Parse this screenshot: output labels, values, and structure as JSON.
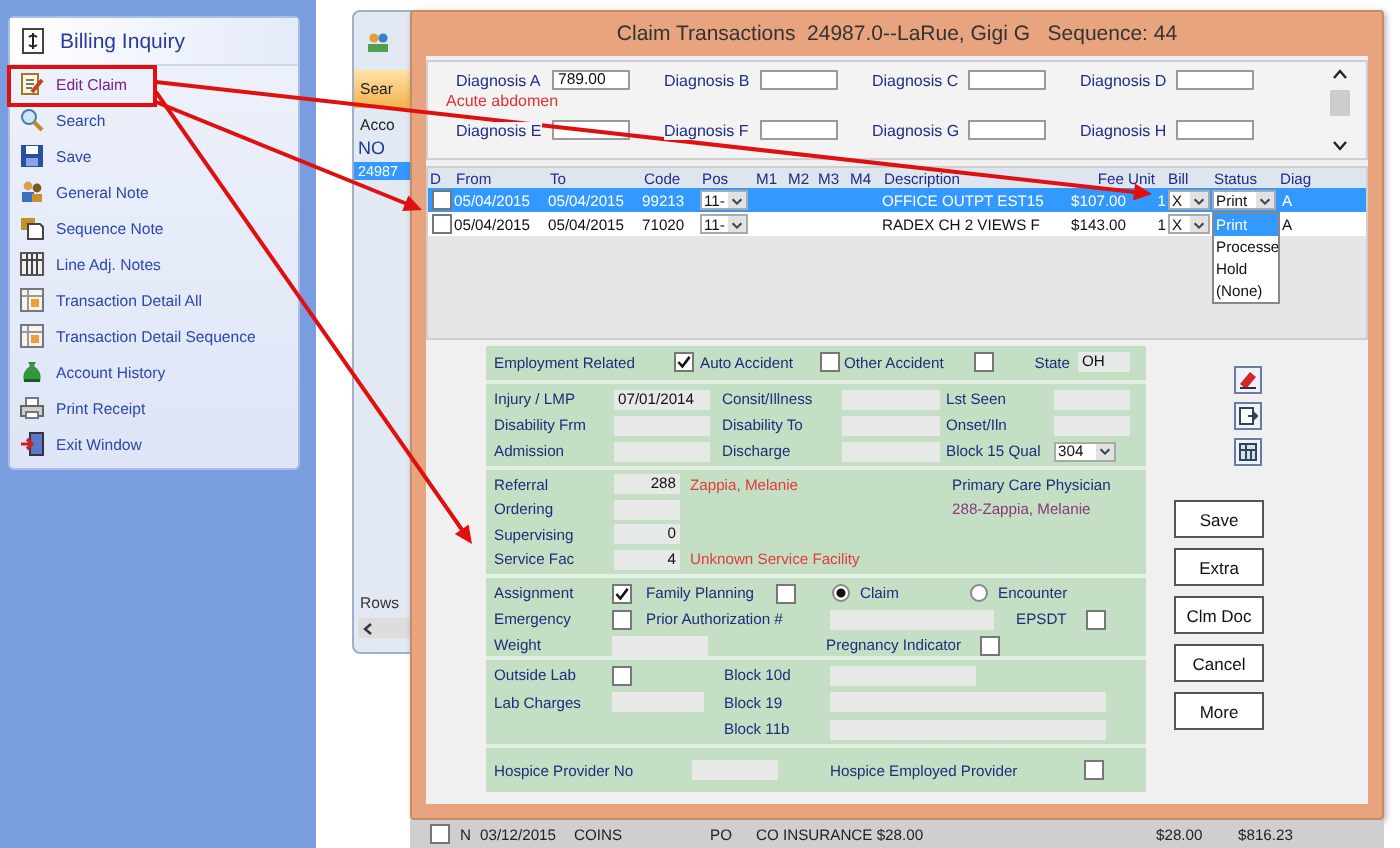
{
  "sidebar": {
    "title": "Billing Inquiry",
    "items": [
      {
        "label": "Edit Claim",
        "selected": true
      },
      {
        "label": "Search",
        "selected": false
      },
      {
        "label": "Save",
        "selected": false
      },
      {
        "label": "General Note",
        "selected": false
      },
      {
        "label": "Sequence Note",
        "selected": false
      },
      {
        "label": "Line Adj. Notes",
        "selected": false
      },
      {
        "label": "Transaction Detail All",
        "selected": false
      },
      {
        "label": "Transaction Detail Sequence",
        "selected": false
      },
      {
        "label": "Account History",
        "selected": false
      },
      {
        "label": "Print Receipt",
        "selected": false
      },
      {
        "label": "Exit Window",
        "selected": false
      }
    ]
  },
  "back_window": {
    "tab": "Sear",
    "column_1": "Acco",
    "rows": [
      {
        "text": "NO",
        "selected": false
      },
      {
        "text": "24987",
        "selected": true
      }
    ],
    "footer": "Rows"
  },
  "dialog": {
    "title": "Claim Transactions  24987.0--LaRue, Gigi G   Sequence: 44",
    "diagnoses": [
      {
        "label": "Diagnosis A",
        "value": "789.00",
        "note": "Acute abdomen"
      },
      {
        "label": "Diagnosis B"
      },
      {
        "label": "Diagnosis C"
      },
      {
        "label": "Diagnosis D"
      },
      {
        "label": "Diagnosis E"
      },
      {
        "label": "Diagnosis F"
      },
      {
        "label": "Diagnosis G"
      },
      {
        "label": "Diagnosis H"
      }
    ],
    "table": {
      "columns": [
        "D",
        "From",
        "To",
        "Code",
        "Pos",
        "M1",
        "M2",
        "M3",
        "M4",
        "Description",
        "Fee",
        "Unit",
        "Bill",
        "Status",
        "Diag"
      ],
      "rows": [
        {
          "selected": true,
          "checked": false,
          "from": "05/04/2015",
          "to": "05/04/2015",
          "code": "99213",
          "pos": "11-",
          "description": "OFFICE OUTPT EST15",
          "fee": "$107.00",
          "unit": "1",
          "bill": "X",
          "status": "Print",
          "diag": "A"
        },
        {
          "selected": false,
          "checked": false,
          "from": "05/04/2015",
          "to": "05/04/2015",
          "code": "71020",
          "pos": "11-",
          "description": "RADEX CH 2 VIEWS F",
          "fee": "$143.00",
          "unit": "1",
          "bill": "X",
          "diag": "A"
        }
      ]
    },
    "status_menu": [
      {
        "label": "Print",
        "selected": true
      },
      {
        "label": "Processe",
        "selected": false
      },
      {
        "label": "Hold",
        "selected": false
      },
      {
        "label": "(None)",
        "selected": false
      }
    ],
    "form": {
      "sections": [
        {
          "rows": [
            {
              "items": [
                {
                  "kind": "label",
                  "text": "Employment Related"
                },
                {
                  "kind": "check",
                  "checked": true
                },
                {
                  "kind": "label",
                  "text": "Auto Accident"
                },
                {
                  "kind": "check",
                  "checked": false
                },
                {
                  "kind": "label",
                  "text": "Other Accident"
                },
                {
                  "kind": "check",
                  "checked": false
                },
                {
                  "kind": "label",
                  "text": "State"
                },
                {
                  "kind": "field",
                  "value": "OH"
                }
              ]
            }
          ]
        },
        {
          "rows": [
            {
              "items": [
                {
                  "kind": "label",
                  "text": "Injury / LMP"
                },
                {
                  "kind": "field",
                  "value": "07/01/2014"
                },
                {
                  "kind": "label",
                  "text": "Consit/Illness"
                },
                {
                  "kind": "field"
                },
                {
                  "kind": "label",
                  "text": "Lst Seen"
                },
                {
                  "kind": "field"
                }
              ]
            },
            {
              "items": [
                {
                  "kind": "label",
                  "text": "Disability Frm"
                },
                {
                  "kind": "field"
                },
                {
                  "kind": "label",
                  "text": "Disability To"
                },
                {
                  "kind": "field"
                },
                {
                  "kind": "label",
                  "text": "Onset/Iln"
                },
                {
                  "kind": "field"
                }
              ]
            },
            {
              "items": [
                {
                  "kind": "label",
                  "text": "Admission"
                },
                {
                  "kind": "field"
                },
                {
                  "kind": "label",
                  "text": "Discharge"
                },
                {
                  "kind": "field"
                },
                {
                  "kind": "label",
                  "text": "Block 15 Qual"
                },
                {
                  "kind": "select",
                  "value": "304"
                }
              ]
            }
          ]
        },
        {
          "rows": [
            {
              "items": [
                {
                  "kind": "label",
                  "text": "Referral"
                },
                {
                  "kind": "field",
                  "value": "288"
                },
                {
                  "kind": "note",
                  "text": "Zappia, Melanie",
                  "color": "#e03c3c"
                },
                {
                  "kind": "side",
                  "text": "Primary Care Physician",
                  "color": "#1f2d7a"
                }
              ]
            },
            {
              "items": [
                {
                  "kind": "label",
                  "text": "Ordering"
                },
                {
                  "kind": "field"
                },
                {
                  "kind": "side",
                  "text": "288-Zappia, Melanie",
                  "color": "#8b3a7a"
                }
              ]
            },
            {
              "items": [
                {
                  "kind": "label",
                  "text": "Supervising"
                },
                {
                  "kind": "field",
                  "value": "0"
                }
              ]
            },
            {
              "items": [
                {
                  "kind": "label",
                  "text": "Service Fac"
                },
                {
                  "kind": "field",
                  "value": "4"
                },
                {
                  "kind": "note",
                  "text": "Unknown Service Facility",
                  "color": "#e03c3c"
                }
              ]
            }
          ]
        },
        {
          "rows": [
            {
              "items": [
                {
                  "kind": "label",
                  "text": "Assignment"
                },
                {
                  "kind": "check",
                  "checked": true
                },
                {
                  "kind": "label",
                  "text": "Family Planning"
                },
                {
                  "kind": "check",
                  "checked": false
                },
                {
                  "kind": "radio",
                  "label": "Claim",
                  "selected": true
                },
                {
                  "kind": "radio",
                  "label": "Encounter",
                  "selected": false
                }
              ]
            },
            {
              "items": [
                {
                  "kind": "label",
                  "text": "Emergency"
                },
                {
                  "kind": "check",
                  "checked": false
                },
                {
                  "kind": "label",
                  "text": "Prior Authorization #"
                },
                {
                  "kind": "field"
                },
                {
                  "kind": "label",
                  "text": "EPSDT"
                },
                {
                  "kind": "check",
                  "checked": false
                }
              ]
            },
            {
              "items": [
                {
                  "kind": "label",
                  "text": "Weight"
                },
                {
                  "kind": "field"
                },
                {
                  "kind": "label",
                  "text": "Pregnancy Indicator"
                },
                {
                  "kind": "check",
                  "checked": false
                }
              ]
            }
          ]
        },
        {
          "rows": [
            {
              "items": [
                {
                  "kind": "label",
                  "text": "Outside Lab"
                },
                {
                  "kind": "check",
                  "checked": false
                },
                {
                  "kind": "label",
                  "text": "Block 10d"
                },
                {
                  "kind": "field"
                }
              ]
            },
            {
              "items": [
                {
                  "kind": "label",
                  "text": "Lab Charges"
                },
                {
                  "kind": "field"
                },
                {
                  "kind": "label",
                  "text": "Block 19"
                },
                {
                  "kind": "field"
                }
              ]
            },
            {
              "items": [
                {
                  "kind": "label",
                  "text": "Block 11b"
                },
                {
                  "kind": "field"
                }
              ]
            }
          ]
        },
        {
          "rows": [
            {
              "items": [
                {
                  "kind": "label",
                  "text": "Hospice Provider No"
                },
                {
                  "kind": "field"
                },
                {
                  "kind": "label",
                  "text": "Hospice Employed Provider"
                },
                {
                  "kind": "check",
                  "checked": false
                }
              ]
            }
          ]
        }
      ]
    },
    "buttons": [
      "Save",
      "Extra",
      "Clm Doc",
      "Cancel",
      "More"
    ]
  },
  "back_table": {
    "rows": [
      {
        "checked": false,
        "cells": [
          "N",
          "03/12/2015",
          "COINS",
          "PO",
          "CO INSURANCE $28.00",
          "$28.00",
          "$816.23"
        ]
      }
    ]
  }
}
